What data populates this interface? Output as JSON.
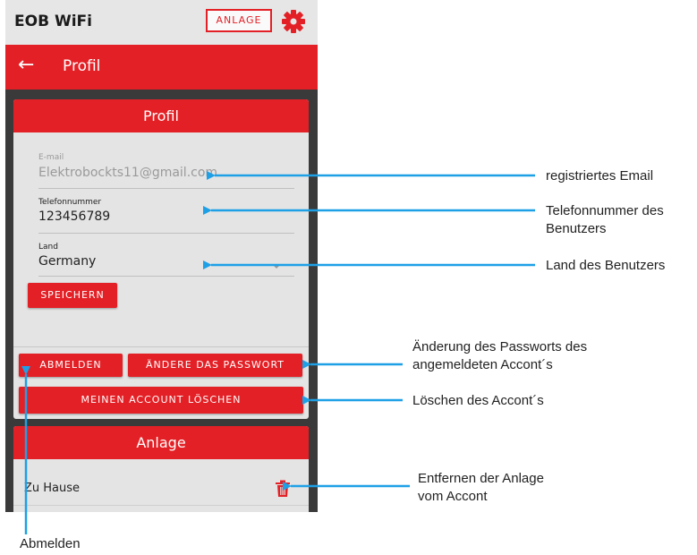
{
  "app": {
    "title": "EOB WiFi",
    "anlage_button": "ANLAGE",
    "gear_icon": "gear-icon",
    "accent_color": "#e32026"
  },
  "appbar": {
    "back_icon": "←",
    "title": "Profil"
  },
  "profile_card": {
    "header": "Profil",
    "email": {
      "label": "E-mail",
      "value": "Elektrobockts11@gmail.com"
    },
    "phone": {
      "label": "Telefonnummer",
      "value": "123456789"
    },
    "country": {
      "label": "Land",
      "value": "Germany"
    },
    "save_button": "SPEICHERN",
    "logout_button": "ABMELDEN",
    "change_password_button": "ÄNDERE DAS PASSWORT",
    "delete_account_button": "MEINEN ACCOUNT LÖSCHEN"
  },
  "anlage_card": {
    "header": "Anlage",
    "items": [
      {
        "label": "Zu Hause",
        "icon": "trash-icon"
      }
    ]
  },
  "annotations": {
    "email": "registriertes Email",
    "phone_line1": "Telefonnummer des",
    "phone_line2": "Benutzers",
    "country": "Land des Benutzers",
    "password_line1": "Änderung des Passworts des",
    "password_line2": "angemeldeten Accont´s",
    "delete_account": "Löschen des Accont´s",
    "remove_line1": "Entfernen der Anlage",
    "remove_line2": "vom Accont",
    "logout": "Abmelden",
    "arrow_color": "#1ea0e6"
  }
}
